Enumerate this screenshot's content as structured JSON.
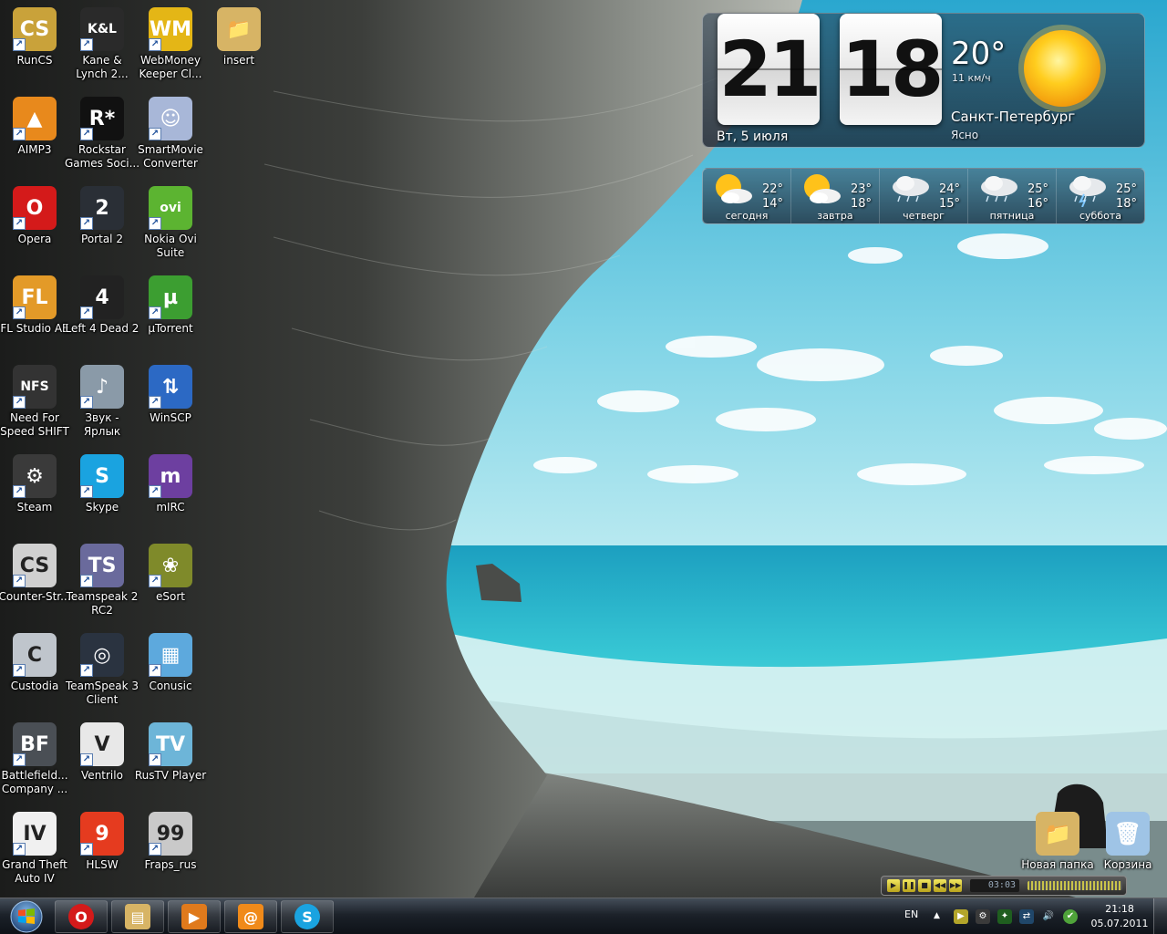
{
  "desktop": {
    "icons_left": [
      {
        "label": "RunCS",
        "icon": "counter-strike-icon",
        "color": "#c9a23a",
        "glyph": "CS"
      },
      {
        "label": "Kane &\nLynch 2...",
        "icon": "kane-lynch-icon",
        "color": "#2a2a2a",
        "glyph": "K&L"
      },
      {
        "label": "WebMoney\nKeeper Cl...",
        "icon": "webmoney-icon",
        "color": "#e4b616",
        "glyph": "WM"
      },
      {
        "label": "insert",
        "icon": "folder-icon",
        "color": "#d7b465",
        "glyph": "📁"
      },
      {
        "label": "AIMP3",
        "icon": "aimp-icon",
        "color": "#e8891c",
        "glyph": "▲"
      },
      {
        "label": "Rockstar\nGames Soci...",
        "icon": "rockstar-icon",
        "color": "#111111",
        "glyph": "R*"
      },
      {
        "label": "SmartMovie\nConverter",
        "icon": "smartmovie-icon",
        "color": "#a8b7d8",
        "glyph": "☺"
      },
      {
        "label": "Opera",
        "icon": "opera-icon",
        "color": "#d41a1a",
        "glyph": "O"
      },
      {
        "label": "Portal 2",
        "icon": "portal-icon",
        "color": "#2a2f36",
        "glyph": "2"
      },
      {
        "label": "Nokia Ovi\nSuite",
        "icon": "nokia-ovi-icon",
        "color": "#5cb431",
        "glyph": "ovi"
      },
      {
        "label": "FL Studio AE",
        "icon": "flstudio-icon",
        "color": "#e39a28",
        "glyph": "FL"
      },
      {
        "label": "Left 4 Dead 2",
        "icon": "left4dead-icon",
        "color": "#222222",
        "glyph": "4"
      },
      {
        "label": "µTorrent",
        "icon": "utorrent-icon",
        "color": "#3c9e31",
        "glyph": "µ"
      },
      {
        "label": "Need For\nSpeed SHIFT",
        "icon": "nfs-icon",
        "color": "#333333",
        "glyph": "NFS"
      },
      {
        "label": "Звук -\nЯрлык",
        "icon": "speaker-icon",
        "color": "#8a9aa8",
        "glyph": "♪"
      },
      {
        "label": "WinSCP",
        "icon": "winscp-icon",
        "color": "#2c69c4",
        "glyph": "⇅"
      },
      {
        "label": "Steam",
        "icon": "steam-icon",
        "color": "#3a3a3a",
        "glyph": "⚙"
      },
      {
        "label": "Skype",
        "icon": "skype-icon",
        "color": "#1aa3e0",
        "glyph": "S"
      },
      {
        "label": "mIRC",
        "icon": "mirc-icon",
        "color": "#6d3fa0",
        "glyph": "m"
      },
      {
        "label": "Counter-Str...",
        "icon": "counter-strike-source-icon",
        "color": "#d0d0d0",
        "glyph": "CS"
      },
      {
        "label": "Teamspeak 2\nRC2",
        "icon": "teamspeak2-icon",
        "color": "#6a6a9c",
        "glyph": "TS"
      },
      {
        "label": "eSort",
        "icon": "esort-icon",
        "color": "#7f8a2a",
        "glyph": "❀"
      },
      {
        "label": "Custodia",
        "icon": "custodia-icon",
        "color": "#bfc5cc",
        "glyph": "C"
      },
      {
        "label": "TeamSpeak 3\nClient",
        "icon": "teamspeak3-icon",
        "color": "#2a3340",
        "glyph": "◎"
      },
      {
        "label": "Conusic",
        "icon": "conusic-icon",
        "color": "#5da9dd",
        "glyph": "▦"
      },
      {
        "label": "Battlefield...\nCompany ...",
        "icon": "battlefield-icon",
        "color": "#4a4f55",
        "glyph": "BF"
      },
      {
        "label": "Ventrilo",
        "icon": "ventrilo-icon",
        "color": "#e8e8e8",
        "glyph": "V"
      },
      {
        "label": "RusTV Player",
        "icon": "rustv-icon",
        "color": "#6db5d8",
        "glyph": "TV"
      },
      {
        "label": "Grand Theft\nAuto IV",
        "icon": "gta4-icon",
        "color": "#f0f0f0",
        "glyph": "IV"
      },
      {
        "label": "HLSW",
        "icon": "hlsw-icon",
        "color": "#e53b1f",
        "glyph": "9"
      },
      {
        "label": "Fraps_rus",
        "icon": "fraps-icon",
        "color": "#c9c9c9",
        "glyph": "99"
      }
    ],
    "icons_right": [
      {
        "label": "Новая папка",
        "icon": "new-folder-icon",
        "color": "#d7b465",
        "glyph": "📁"
      },
      {
        "label": "Корзина",
        "icon": "recycle-bin-icon",
        "color": "#9fc4e6",
        "glyph": "🗑"
      }
    ]
  },
  "clock_gadget": {
    "hours": "21",
    "minutes": "18",
    "date": "Вт, 5 июля",
    "temperature": "20°",
    "wind": "11 км/ч",
    "city": "Санкт-Петербург",
    "condition": "Ясно"
  },
  "forecast": [
    {
      "day": "сегодня",
      "hi": "22°",
      "lo": "14°",
      "icon": "partly-cloudy-icon"
    },
    {
      "day": "завтра",
      "hi": "23°",
      "lo": "18°",
      "icon": "partly-cloudy-icon"
    },
    {
      "day": "четверг",
      "hi": "24°",
      "lo": "15°",
      "icon": "rain-cloud-icon"
    },
    {
      "day": "пятница",
      "hi": "25°",
      "lo": "16°",
      "icon": "rain-cloud-icon"
    },
    {
      "day": "суббота",
      "hi": "25°",
      "lo": "18°",
      "icon": "thunderstorm-icon"
    }
  ],
  "mini_player": {
    "time": "03:03"
  },
  "taskbar": {
    "pinned": [
      {
        "name": "opera",
        "icon": "opera-icon",
        "color": "#d41a1a",
        "glyph": "O"
      },
      {
        "name": "explorer",
        "icon": "folder-icon",
        "color": "#d7b465",
        "glyph": "▤"
      },
      {
        "name": "media-player",
        "icon": "media-player-icon",
        "color": "#e07a1c",
        "glyph": "▶"
      },
      {
        "name": "mail-agent",
        "icon": "mail-agent-icon",
        "color": "#f08a1a",
        "glyph": "@"
      },
      {
        "name": "skype",
        "icon": "skype-icon",
        "color": "#1aa3e0",
        "glyph": "S"
      }
    ],
    "language": "EN",
    "time": "21:18",
    "date": "05.07.2011"
  },
  "colors": {
    "sky": "#5ec8e0",
    "sea": "#1fb5c9",
    "rock": "#6f726c"
  }
}
